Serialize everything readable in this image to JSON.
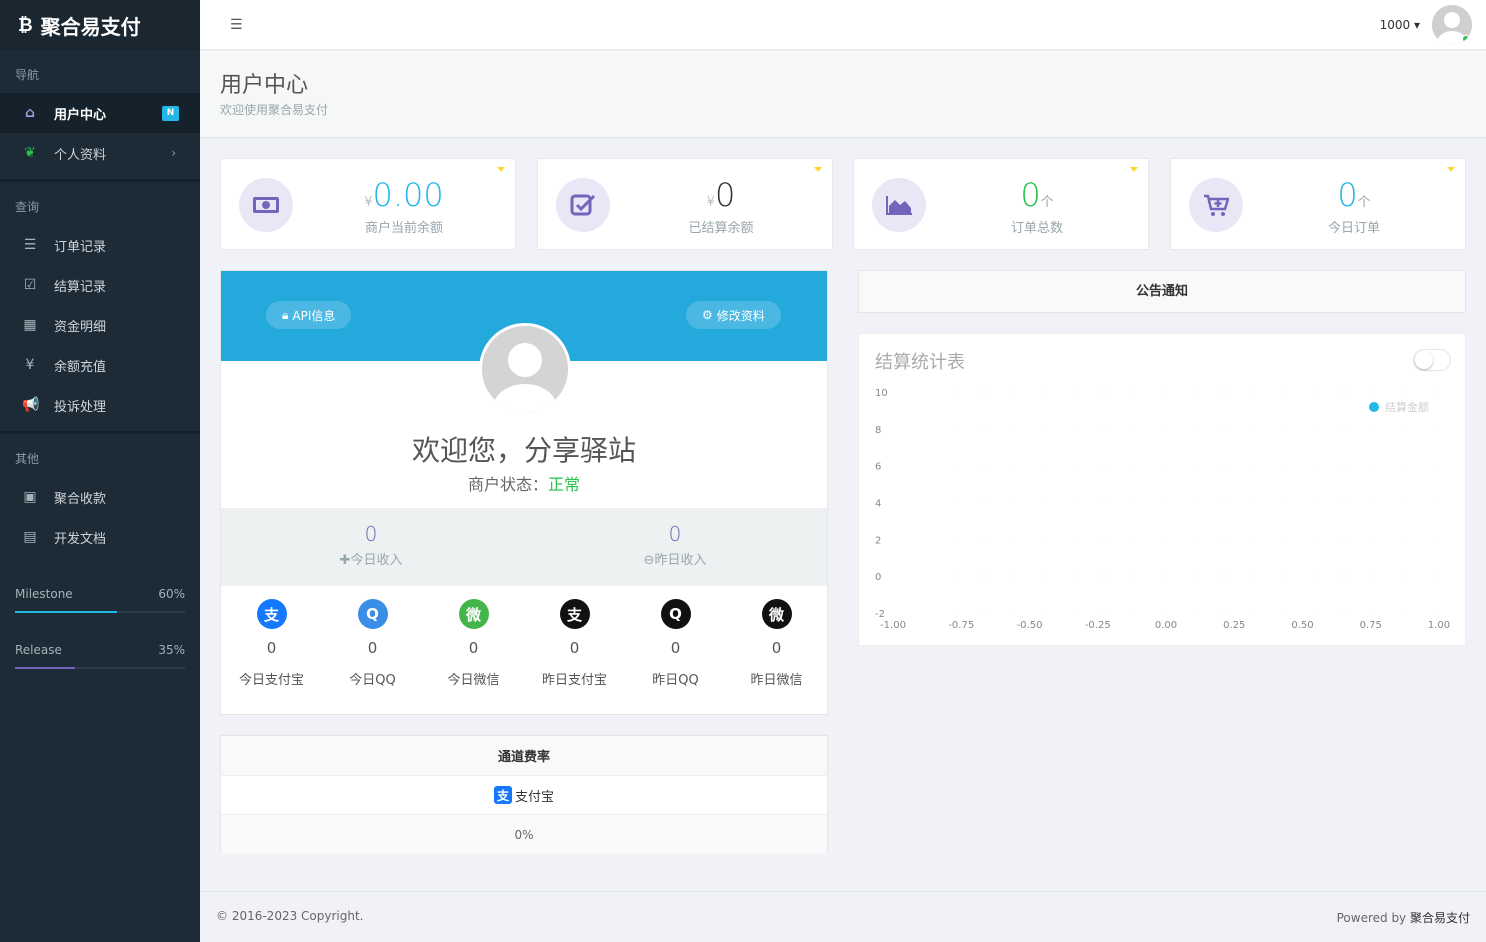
{
  "brand": {
    "icon": "bitcoin-icon",
    "name": "聚合易支付"
  },
  "sidebar": {
    "section_nav": "导航",
    "section_query": "查询",
    "section_other": "其他",
    "nav": [
      {
        "label": "用户中心",
        "icon": "home-icon",
        "badge": "N"
      },
      {
        "label": "个人资料",
        "icon": "leaf-icon"
      }
    ],
    "query": [
      {
        "label": "订单记录",
        "icon": "list-icon"
      },
      {
        "label": "结算记录",
        "icon": "check-square-icon"
      },
      {
        "label": "资金明细",
        "icon": "table-icon"
      },
      {
        "label": "余额充值",
        "icon": "yen-icon"
      },
      {
        "label": "投诉处理",
        "icon": "bullhorn-icon"
      }
    ],
    "other": [
      {
        "label": "聚合收款",
        "icon": "qrcode-icon"
      },
      {
        "label": "开发文档",
        "icon": "book-icon"
      }
    ],
    "progress": [
      {
        "label": "Milestone",
        "value": "60%",
        "fraction": 0.6,
        "color": "#23b7e5"
      },
      {
        "label": "Release",
        "value": "35%",
        "fraction": 0.35,
        "color": "#7266ba"
      }
    ]
  },
  "header": {
    "user_id": "1000"
  },
  "page": {
    "title": "用户中心",
    "subtitle": "欢迎使用聚合易支付"
  },
  "stats": [
    {
      "prefix": "¥",
      "value": "0.00",
      "suffix": "",
      "label": "商户当前余额",
      "icon": "money-icon"
    },
    {
      "prefix": "¥",
      "value": "0",
      "suffix": "",
      "label": "已结算余额",
      "icon": "check-square-icon"
    },
    {
      "prefix": "",
      "value": "0",
      "suffix": "个",
      "label": "订单总数",
      "icon": "area-chart-icon"
    },
    {
      "prefix": "",
      "value": "0",
      "suffix": "个",
      "label": "今日订单",
      "icon": "cart-plus-icon"
    }
  ],
  "profile": {
    "api_button": "API信息",
    "edit_button": "修改资料",
    "welcome": "欢迎您，分享驿站",
    "status_label": "商户状态：",
    "status_value": "正常",
    "income_today": {
      "value": "0",
      "label": "今日收入"
    },
    "income_yesterday": {
      "value": "0",
      "label": "昨日收入"
    },
    "pay_stats": [
      {
        "label": "今日支付宝",
        "value": "0",
        "icon": "alipay-icon",
        "color": "#1677ff",
        "glyph": "支"
      },
      {
        "label": "今日QQ",
        "value": "0",
        "icon": "qq-icon",
        "color": "#3a8ee6",
        "glyph": "Q"
      },
      {
        "label": "今日微信",
        "value": "0",
        "icon": "wechat-icon",
        "color": "#44b549",
        "glyph": "微"
      },
      {
        "label": "昨日支付宝",
        "value": "0",
        "icon": "alipay-icon",
        "color": "#111111",
        "glyph": "支"
      },
      {
        "label": "昨日QQ",
        "value": "0",
        "icon": "qq-icon",
        "color": "#111111",
        "glyph": "Q"
      },
      {
        "label": "昨日微信",
        "value": "0",
        "icon": "wechat-icon",
        "color": "#111111",
        "glyph": "微"
      }
    ]
  },
  "rates": {
    "title": "通道费率",
    "channel": "支付宝",
    "rate": "0%"
  },
  "notice": {
    "title": "公告通知"
  },
  "chart_data": {
    "type": "line",
    "title": "结算统计表",
    "series": [
      {
        "name": "结算金额",
        "values": []
      }
    ],
    "x": [],
    "xlim": [
      -1.0,
      1.0
    ],
    "ylim": [
      -2,
      10
    ],
    "xticks": [
      "-1.00",
      "-0.75",
      "-0.50",
      "-0.25",
      "0.00",
      "0.25",
      "0.50",
      "0.75",
      "1.00"
    ],
    "yticks": [
      "10",
      "8",
      "6",
      "4",
      "2",
      "0",
      "-2"
    ],
    "legend_position": "top-right",
    "series_color": "#23b7e5",
    "grid": true
  },
  "footer": {
    "copyright": "© 2016-2023 Copyright.",
    "powered_prefix": "Powered by ",
    "powered_name": "聚合易支付"
  }
}
